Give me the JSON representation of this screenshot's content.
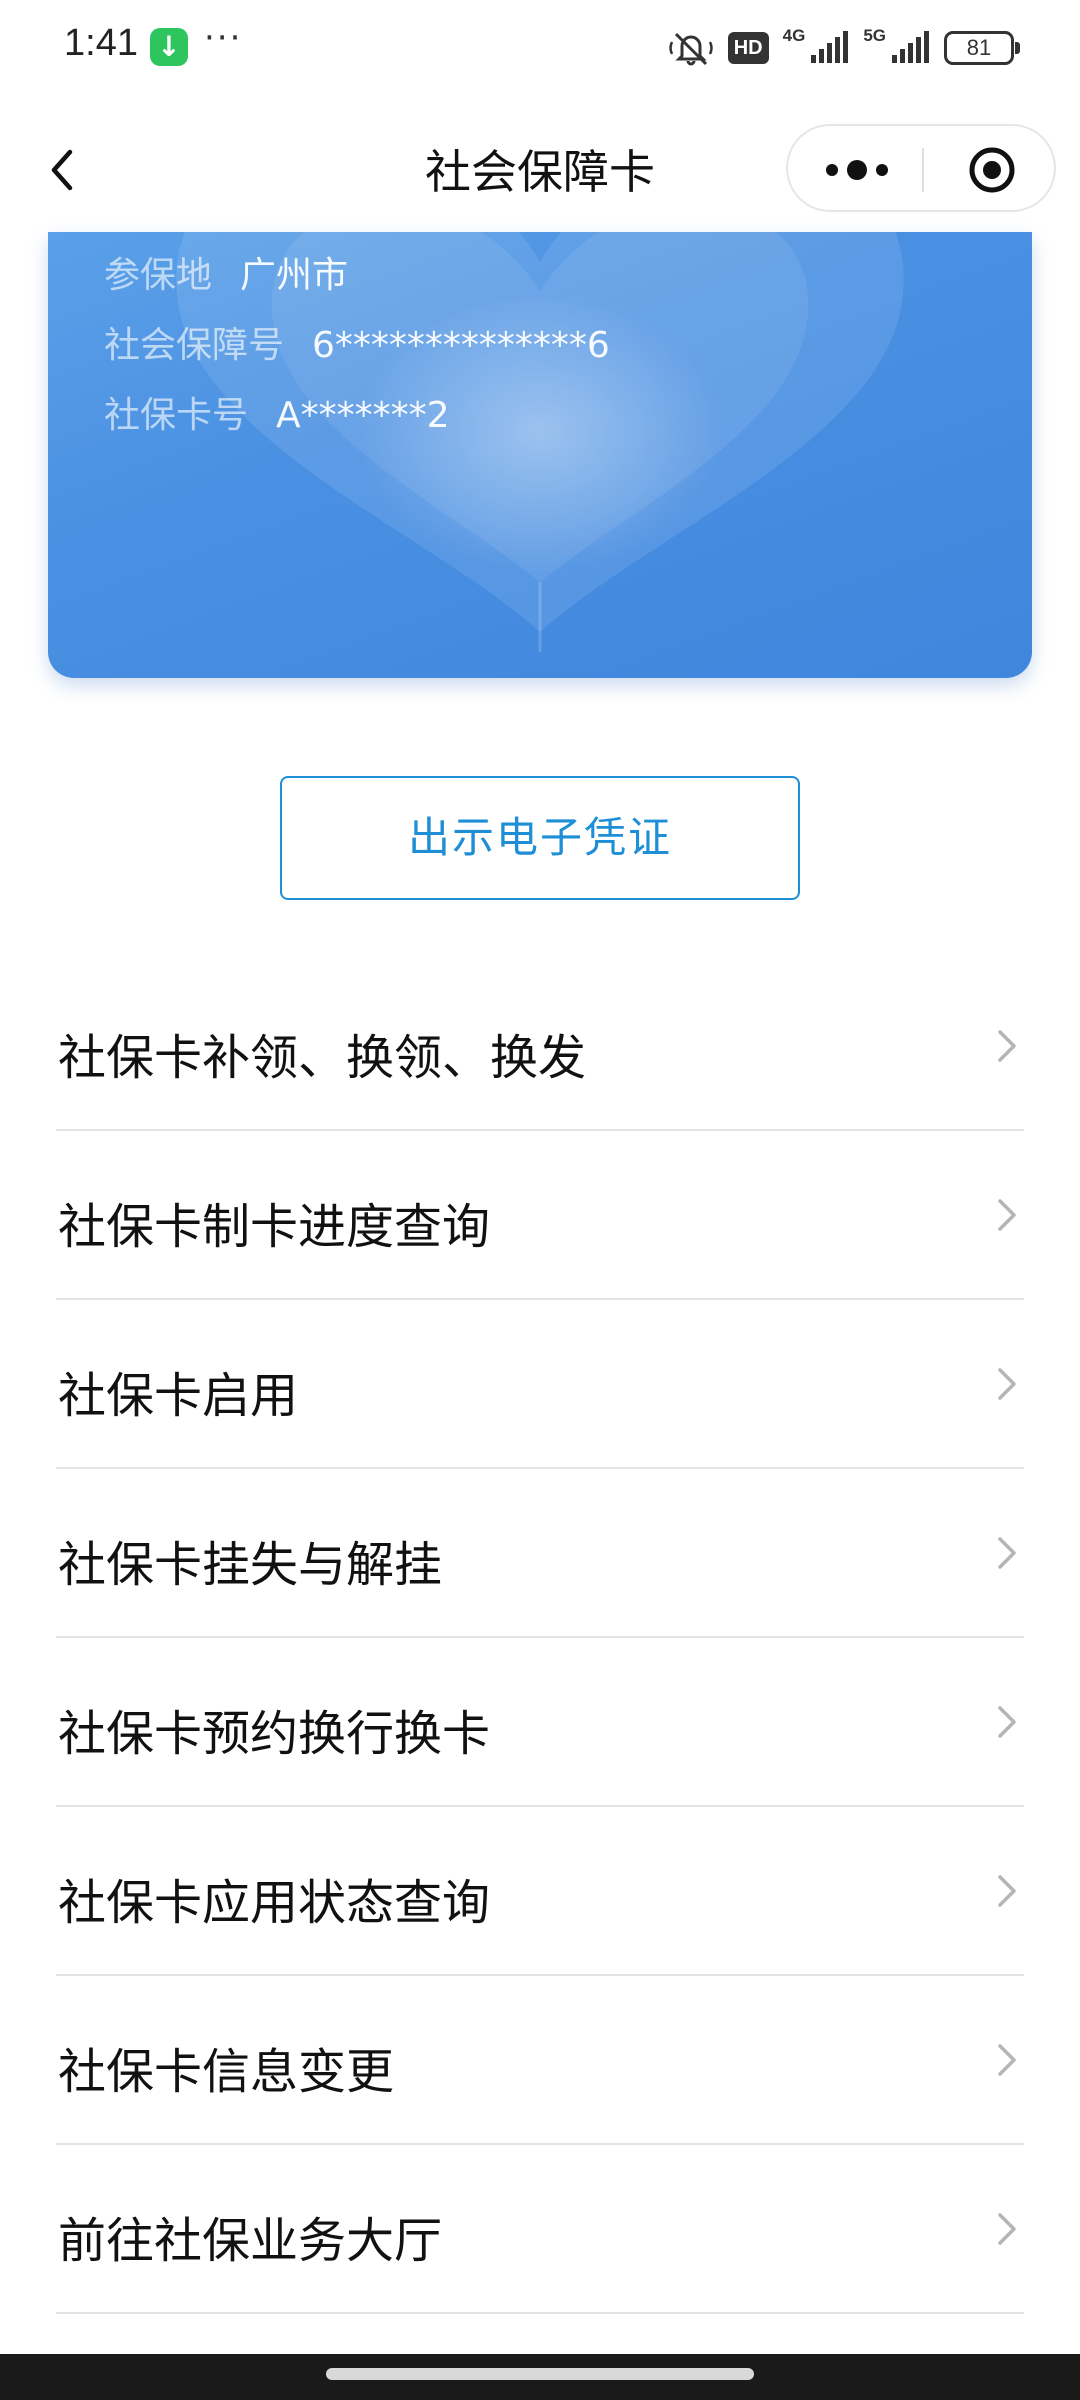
{
  "status_bar": {
    "time": "1:41",
    "app_icon": "download-arrow-icon",
    "more": "···",
    "hd_label": "HD",
    "net_4g": "4G",
    "net_5g": "5G",
    "battery": "81"
  },
  "nav": {
    "title": "社会保障卡",
    "back_icon": "chevron-left-icon",
    "more_icon": "more-dots-icon",
    "close_icon": "target-circle-icon"
  },
  "card": {
    "rows": [
      {
        "label": "参保地",
        "value": "广州市"
      },
      {
        "label": "社会保障号",
        "value": "6**************6"
      },
      {
        "label": "社保卡号",
        "value": "A*******2"
      }
    ],
    "colors": {
      "primary": "#4a90e2",
      "light": "#5aa0e8"
    }
  },
  "credential_button": {
    "label": "出示电子凭证",
    "color": "#1e8fd6"
  },
  "menu": {
    "items": [
      {
        "label": "社保卡补领、换领、换发"
      },
      {
        "label": "社保卡制卡进度查询"
      },
      {
        "label": "社保卡启用"
      },
      {
        "label": "社保卡挂失与解挂"
      },
      {
        "label": "社保卡预约换行换卡"
      },
      {
        "label": "社保卡应用状态查询"
      },
      {
        "label": "社保卡信息变更"
      },
      {
        "label": "前往社保业务大厅"
      }
    ],
    "chevron_icon": "chevron-right-icon"
  }
}
